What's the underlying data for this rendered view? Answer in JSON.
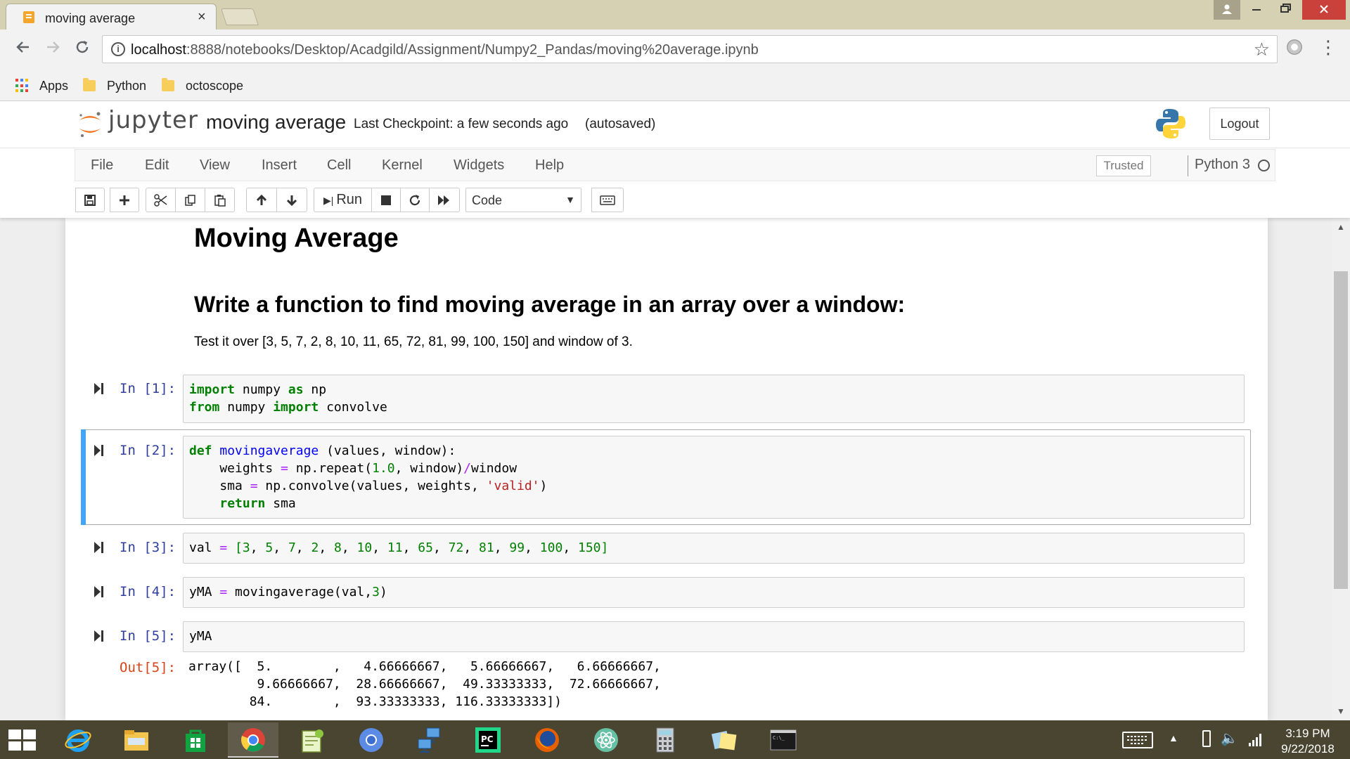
{
  "browser": {
    "tab_title": "moving average",
    "tab_close": "×",
    "url_host": "localhost",
    "url_rest": ":8888/notebooks/Desktop/Acadgild/Assignment/Numpy2_Pandas/moving%20average.ipynb",
    "bookmarks": [
      {
        "label": "Apps",
        "icon": "apps-grid-icon"
      },
      {
        "label": "Python",
        "icon": "folder-icon"
      },
      {
        "label": "octoscope",
        "icon": "folder-icon"
      }
    ]
  },
  "jupyter": {
    "logo_text": "jupyter",
    "notebook_name": "moving average",
    "checkpoint": "Last Checkpoint: a few seconds ago",
    "autosave": "(autosaved)",
    "logout": "Logout",
    "menu": [
      "File",
      "Edit",
      "View",
      "Insert",
      "Cell",
      "Kernel",
      "Widgets",
      "Help"
    ],
    "trusted": "Trusted",
    "kernel": "Python 3",
    "toolbar": {
      "run_label": "Run",
      "cell_type": "Code"
    }
  },
  "notebook": {
    "h1": "Moving Average",
    "h2": "Write a function to find moving average in an array over a window:",
    "paragraph": "Test it over [3, 5, 7, 2, 8, 10, 11, 65, 72, 81, 99, 100, 150] and window of 3.",
    "cells": [
      {
        "prompt": "In [1]:"
      },
      {
        "prompt": "In [2]:"
      },
      {
        "prompt": "In [3]:"
      },
      {
        "prompt": "In [4]:"
      },
      {
        "prompt": "In [5]:",
        "out_prompt": "Out[5]:"
      }
    ],
    "code": {
      "c1_l1": [
        "import",
        " numpy ",
        "as",
        " np"
      ],
      "c1_l2": [
        "from",
        " numpy ",
        "import",
        " convolve"
      ],
      "c2_l1": [
        "def",
        " ",
        "movingaverage",
        " (values, window):"
      ],
      "c2_l2": [
        "    weights ",
        "=",
        " np.repeat(",
        "1.0",
        ", window)",
        "/",
        "window"
      ],
      "c2_l3": [
        "    sma ",
        "=",
        " np.convolve(values, weights, ",
        "'valid'",
        ")"
      ],
      "c2_l4": [
        "    ",
        "return",
        " sma"
      ],
      "c3": [
        "val ",
        "=",
        " [",
        "3",
        ", ",
        "5",
        ", ",
        "7",
        ", ",
        "2",
        ", ",
        "8",
        ", ",
        "10",
        ", ",
        "11",
        ", ",
        "65",
        ", ",
        "72",
        ", ",
        "81",
        ", ",
        "99",
        ", ",
        "100",
        ", ",
        "150",
        "]"
      ],
      "c4": [
        "yMA ",
        "=",
        " movingaverage(val,",
        "3",
        ")"
      ],
      "c5": "yMA"
    },
    "output": "array([  5.        ,   4.66666667,   5.66666667,   6.66666667,\n         9.66666667,  28.66666667,  49.33333333,  72.66666667,\n        84.        ,  93.33333333, 116.33333333])"
  },
  "taskbar": {
    "time": "3:19 PM",
    "date": "9/22/2018"
  }
}
